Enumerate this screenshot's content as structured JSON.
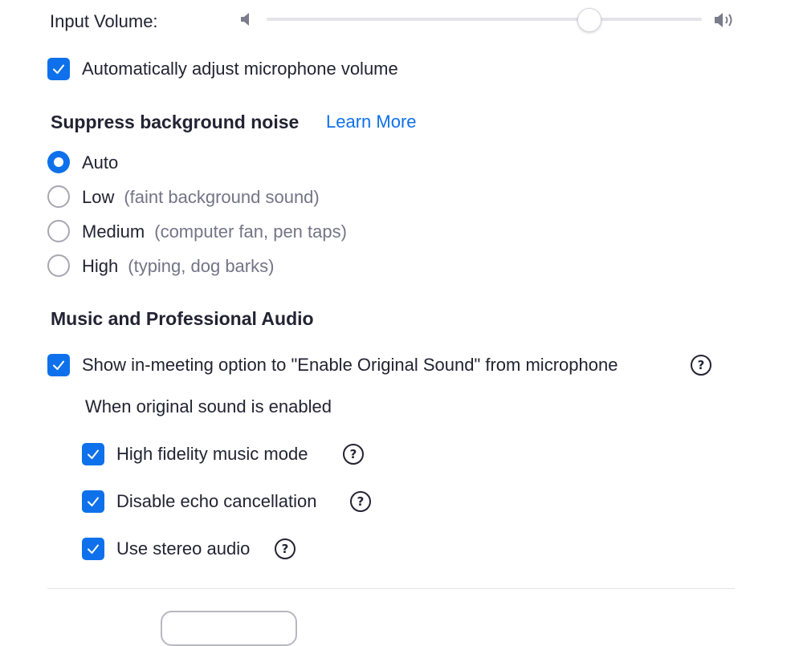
{
  "input_volume": {
    "label": "Input Volume:",
    "level": 0.74
  },
  "auto_adjust": {
    "checked": true,
    "label": "Automatically adjust microphone volume"
  },
  "suppress_noise": {
    "heading": "Suppress background noise",
    "learn_more": "Learn More",
    "selected": "Auto",
    "options": [
      {
        "label": "Auto",
        "desc": ""
      },
      {
        "label": "Low",
        "desc": "(faint background sound)"
      },
      {
        "label": "Medium",
        "desc": "(computer fan, pen taps)"
      },
      {
        "label": "High",
        "desc": "(typing, dog barks)"
      }
    ]
  },
  "music_audio": {
    "heading": "Music and Professional Audio",
    "show_original_sound": {
      "checked": true,
      "label": "Show in-meeting option to \"Enable Original Sound\" from microphone"
    },
    "subheading": "When original sound is enabled",
    "suboptions": [
      {
        "label": "High fidelity music mode",
        "checked": true
      },
      {
        "label": "Disable echo cancellation",
        "checked": true
      },
      {
        "label": "Use stereo audio",
        "checked": true
      }
    ]
  },
  "icons": {
    "help": "?",
    "speaker_low": "speaker-low-icon",
    "speaker_high": "speaker-high-icon"
  },
  "colors": {
    "accent": "#0e71eb",
    "text": "#232333",
    "muted": "#747487"
  }
}
